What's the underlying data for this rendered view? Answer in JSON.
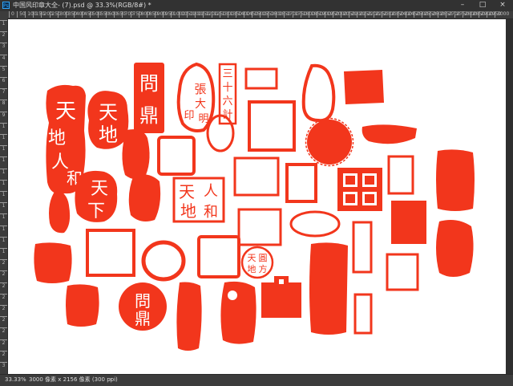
{
  "window": {
    "app_icon_label": "Ps",
    "title": "中国风印章大全- (7).psd @ 33.3%(RGB/8#) *",
    "controls": {
      "minimize": "–",
      "maximize": "□",
      "close": "×"
    }
  },
  "ruler": {
    "horizontal": [
      "0",
      "50",
      "100",
      "150",
      "200",
      "250",
      "300",
      "350",
      "400",
      "450",
      "500",
      "550",
      "600",
      "650",
      "700",
      "750",
      "800",
      "850",
      "900",
      "950",
      "1000",
      "1050",
      "1100",
      "1150",
      "1200",
      "1250",
      "1300",
      "1350",
      "1400",
      "1450",
      "1500",
      "1550",
      "1600",
      "1650",
      "1700",
      "1750",
      "1800",
      "1850",
      "1900",
      "1950",
      "2000",
      "2050",
      "2100",
      "2150",
      "2200",
      "2250",
      "2300",
      "2350",
      "2400",
      "2450",
      "2500",
      "2550",
      "2600",
      "2650",
      "2700",
      "2750",
      "2800",
      "2850",
      "2900",
      "2950",
      "3000"
    ],
    "vertical": [
      "1",
      "2",
      "3",
      "4",
      "5",
      "6",
      "7",
      "8",
      "9",
      "1",
      "1",
      "1",
      "1",
      "1",
      "1",
      "1",
      "1",
      "1",
      "1",
      "1",
      "1",
      "2",
      "2",
      "2",
      "2",
      "2",
      "2",
      "2",
      "2",
      "2",
      "3"
    ]
  },
  "status": {
    "zoom": "33.33%",
    "doc_size": "3000 像素 x 2156 像素 (300 ppi)",
    "arrow": "›"
  },
  "colors": {
    "seal_red": "#f2361c",
    "canvas": "#ffffff",
    "chrome": "#323232"
  },
  "seals": {
    "tiandi_renhe_col": "天地人和",
    "tiandi": "天地",
    "tianxia": "天下",
    "wending": "問鼎",
    "zhang_yin": "張大明印",
    "sanshiliu": "三十六計",
    "tiandi_renhe_sq": [
      "天",
      "人",
      "地",
      "和"
    ],
    "tianyuan": [
      "天",
      "圓",
      "方",
      "地"
    ],
    "wending_round": "問鼎"
  }
}
